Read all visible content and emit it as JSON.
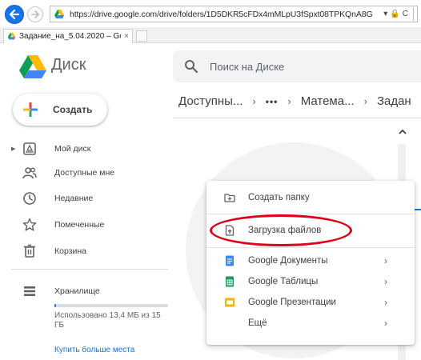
{
  "browser": {
    "url": "https://drive.google.com/drive/folders/1D5DKR5cFDx4mMLpU3fSpxt08TPKQnA8G",
    "url_tools": [
      "▾",
      "🔒",
      "C"
    ],
    "tab_title": "Задание_на_5.04.2020 – Go...",
    "tab_close": "×"
  },
  "header": {
    "app_name": "Диск",
    "search_placeholder": "Поиск на Диске"
  },
  "sidebar": {
    "new_button": "Создать",
    "items": [
      {
        "label": "Мой диск",
        "icon": "my-drive-icon"
      },
      {
        "label": "Доступные мне",
        "icon": "shared-with-me-icon"
      },
      {
        "label": "Недавние",
        "icon": "clock-icon"
      },
      {
        "label": "Помеченные",
        "icon": "star-icon"
      },
      {
        "label": "Корзина",
        "icon": "trash-icon"
      }
    ],
    "storage": {
      "label": "Хранилище",
      "used_text": "Использовано 13,4 МБ из 15 ГБ",
      "used_fraction": 0.01,
      "buy_link": "Купить больше места"
    }
  },
  "breadcrumb": {
    "parts": [
      "Доступны...",
      "•••",
      "Матема...",
      "Задан"
    ],
    "separator": "›"
  },
  "new_menu": {
    "items": [
      {
        "label": "Создать папку",
        "icon": "new-folder-icon"
      },
      {
        "label": "Загрузка файлов",
        "icon": "file-upload-icon",
        "highlighted": true
      },
      {
        "label": "Google Документы",
        "icon": "google-docs-icon",
        "submenu": true
      },
      {
        "label": "Google Таблицы",
        "icon": "google-sheets-icon",
        "submenu": true
      },
      {
        "label": "Google Презентации",
        "icon": "google-slides-icon",
        "submenu": true
      },
      {
        "label": "Ещё",
        "submenu": true
      }
    ],
    "submenu_glyph": "›"
  },
  "colors": {
    "accent_blue": "#1a73e8",
    "highlight_red": "#e0001a",
    "docs_blue": "#4285f4",
    "sheets_green": "#0f9d58",
    "slides_yellow": "#f4b400"
  }
}
